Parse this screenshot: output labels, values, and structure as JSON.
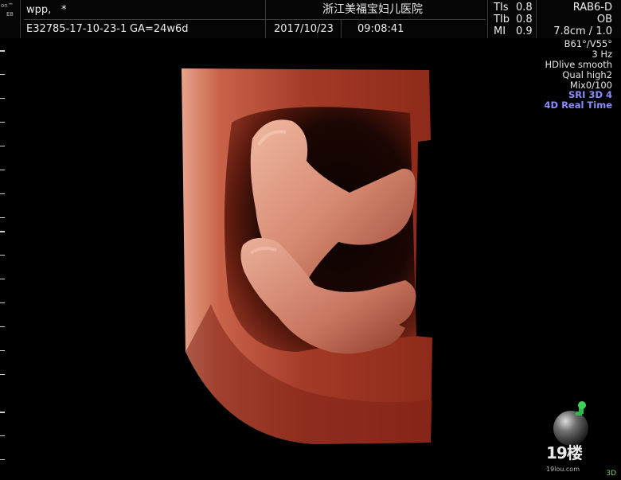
{
  "header": {
    "logo_small_top": "on™",
    "logo_small_bottom": "E8",
    "patient_name": "wpp,",
    "star": "*",
    "patient_id": "E32785-17-10-23-1",
    "gestational_age": "GA=24w6d",
    "hospital": "浙江美福宝妇儿医院",
    "date": "2017/10/23",
    "time": "09:08:41",
    "tis_label": "TIs",
    "tis_value": "0.8",
    "tib_label": "TIb",
    "tib_value": "0.8",
    "mi_label": "MI",
    "mi_value": "0.9",
    "probe": "RAB6-D",
    "preset": "OB",
    "depth": "7.8cm / 1.0"
  },
  "params": [
    "B61°/V55°",
    "3 Hz",
    "HDlive smooth",
    "Qual high2",
    "Mix0/100",
    "SRI 3D 4",
    "4D Real Time"
  ],
  "colors": {
    "highlight_param": "#8c8cff",
    "tissue_light": "#e9a08a",
    "tissue_dark": "#7a1e12",
    "background": "#000000",
    "orientation_marker": "#2fb84a"
  },
  "icons": {
    "orientation": "orientation-sphere-icon"
  },
  "watermark": {
    "logo_text": "19楼",
    "domain": "19lou.com"
  },
  "corner_mode": "3D"
}
